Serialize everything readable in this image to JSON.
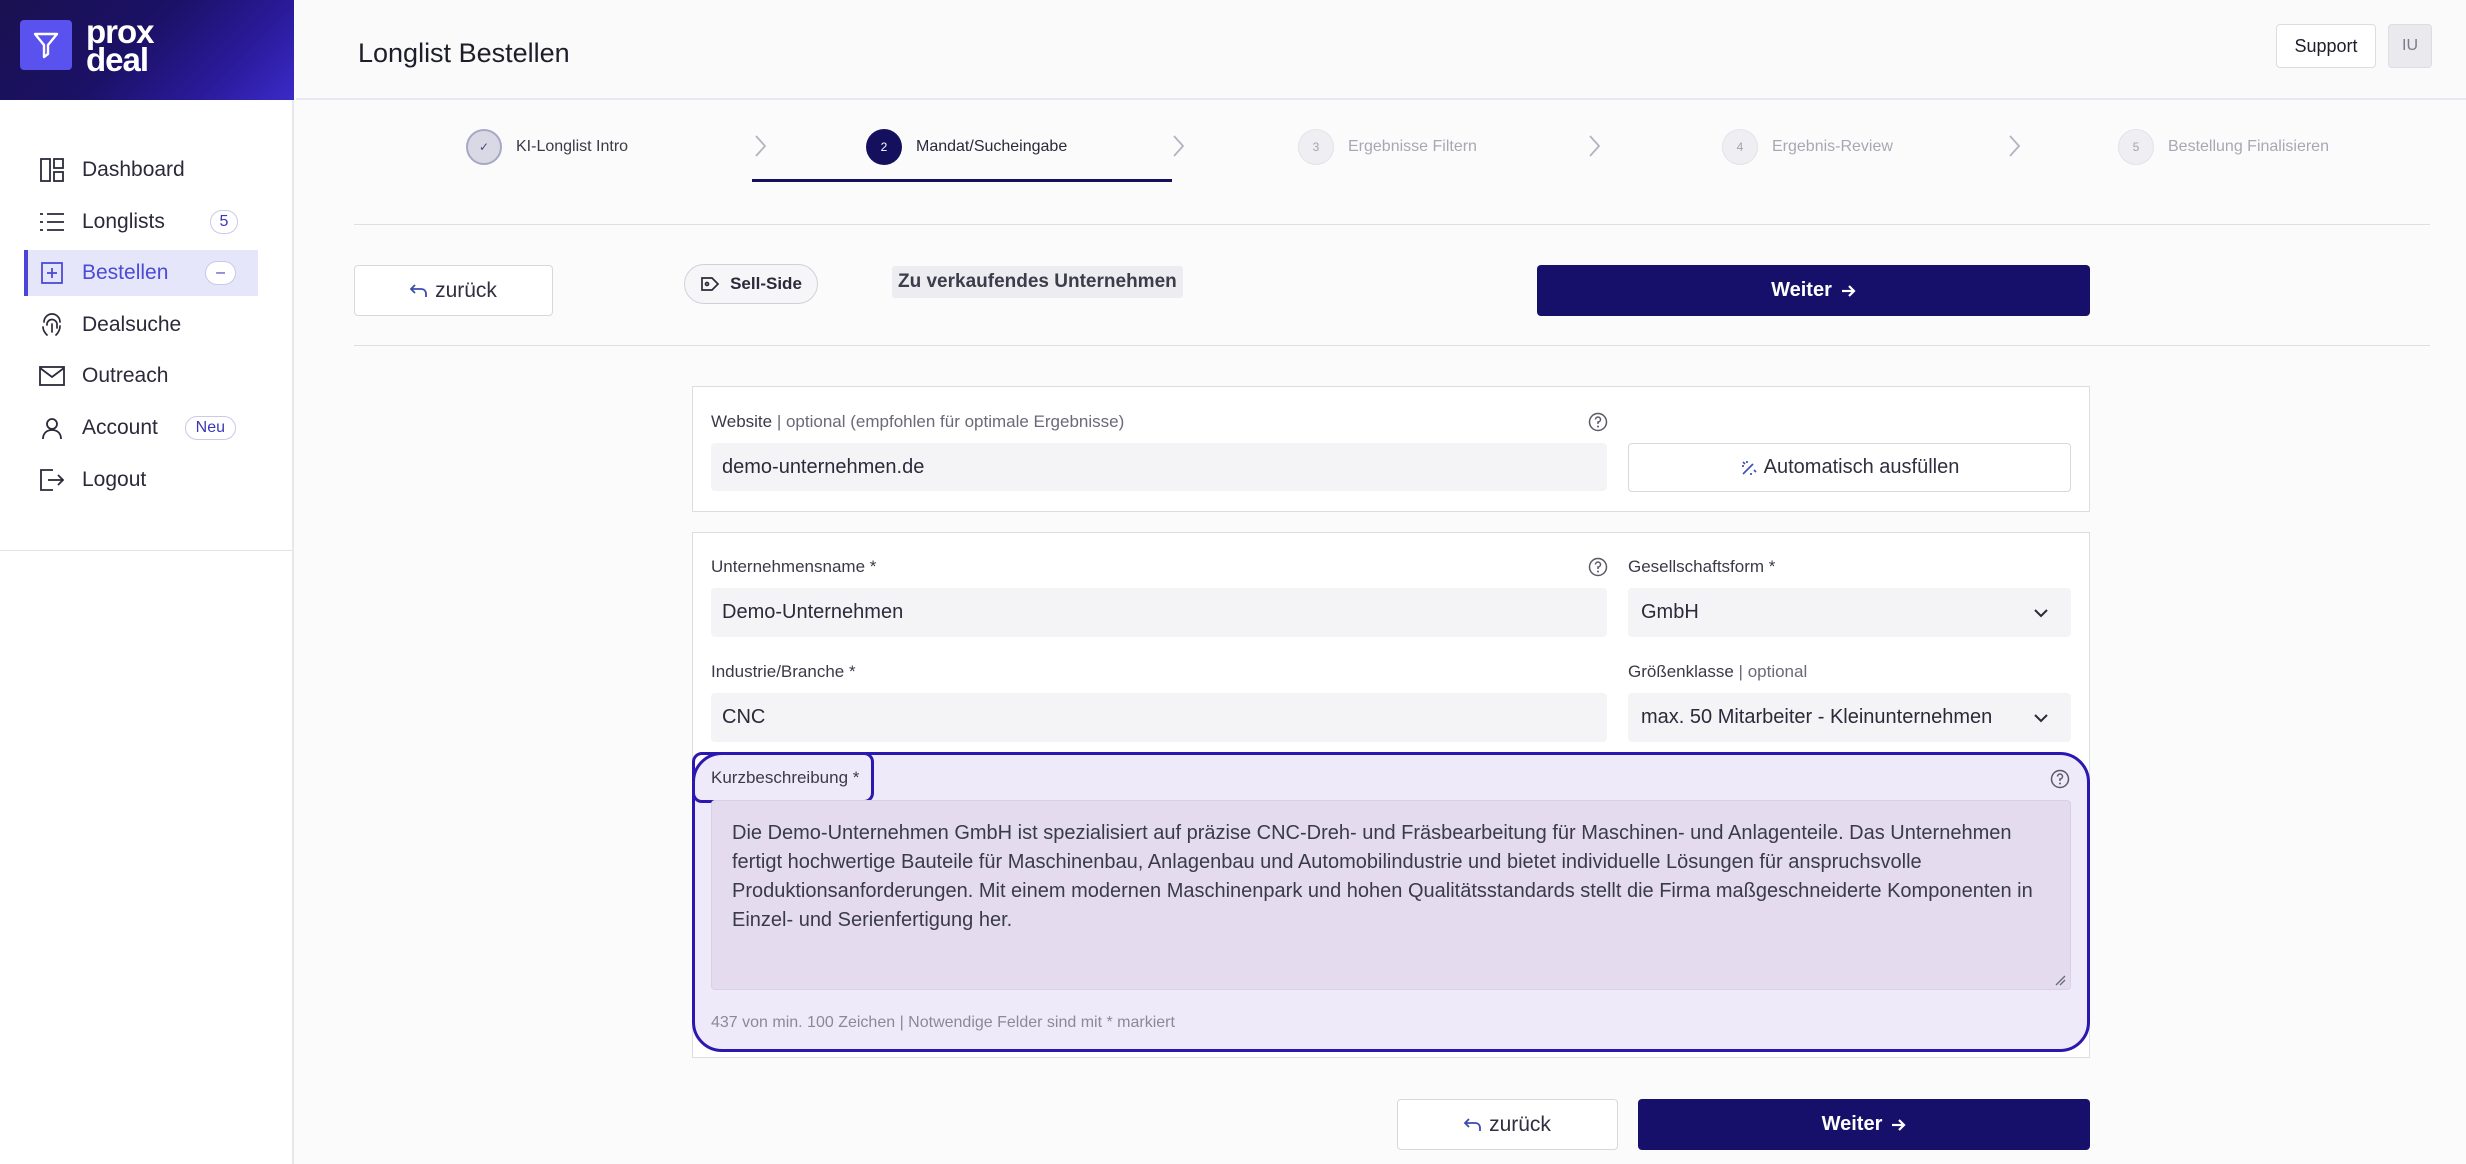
{
  "brand": {
    "name_line1": "prox",
    "name_line2": "deal",
    "logo_icon": "funnel-icon"
  },
  "sidebar": {
    "items": [
      {
        "label": "Dashboard",
        "icon": "dashboard-icon"
      },
      {
        "label": "Longlists",
        "icon": "list-icon",
        "badge": "5"
      },
      {
        "label": "Bestellen",
        "icon": "plus-square-icon",
        "badge": "–",
        "active": true
      },
      {
        "label": "Dealsuche",
        "icon": "fingerprint-icon"
      },
      {
        "label": "Outreach",
        "icon": "mail-icon"
      },
      {
        "label": "Account",
        "icon": "user-icon",
        "badge": "Neu"
      },
      {
        "label": "Logout",
        "icon": "logout-icon"
      }
    ]
  },
  "header": {
    "title": "Longlist Bestellen",
    "support_label": "Support",
    "avatar_initials": "IU"
  },
  "stepper": {
    "steps": [
      {
        "marker": "✓",
        "label": "KI-Longlist Intro",
        "state": "done"
      },
      {
        "marker": "2",
        "label": "Mandat/Sucheingabe",
        "state": "current"
      },
      {
        "marker": "3",
        "label": "Ergebnisse Filtern",
        "state": "future"
      },
      {
        "marker": "4",
        "label": "Ergebnis-Review",
        "state": "future"
      },
      {
        "marker": "5",
        "label": "Bestellung Finalisieren",
        "state": "future"
      }
    ]
  },
  "actions": {
    "back_label": "zurück",
    "side_label": "Sell-Side",
    "target_label": "Zu verkaufendes Unternehmen",
    "next_label": "Weiter"
  },
  "form": {
    "website": {
      "label": "Website",
      "optional": " | optional (empfohlen für optimale Ergebnisse)",
      "value": "demo-unternehmen.de",
      "autofill_label": "Automatisch ausfüllen"
    },
    "company_name": {
      "label": "Unternehmensname *",
      "value": "Demo-Unternehmen"
    },
    "legal_form": {
      "label": "Gesellschaftsform *",
      "value": "GmbH"
    },
    "industry": {
      "label": "Industrie/Branche *",
      "value": "CNC"
    },
    "size_class": {
      "label": "Größenklasse",
      "optional": " | optional",
      "value": "max. 50 Mitarbeiter - Kleinunternehmen"
    },
    "description": {
      "label": "Kurzbeschreibung *",
      "value": "Die Demo-Unternehmen GmbH ist spezialisiert auf präzise CNC-Dreh- und Fräsbearbeitung für Maschinen- und Anlagenteile. Das Unternehmen fertigt hochwertige Bauteile für Maschinenbau, Anlagenbau und Automobilindustrie und bietet individuelle Lösungen für anspruchsvolle Produktionsanforderungen. Mit einem modernen Maschinenpark und hohen Qualitätsstandards stellt die Firma maßgeschneiderte Komponenten in Einzel- und Serienfertigung her.",
      "hint": "437 von min. 100 Zeichen | Notwendige Felder sind mit * markiert"
    }
  },
  "colors": {
    "primary": "#16106a",
    "accent": "#4b44d6",
    "highlight": "#2a18b0"
  }
}
